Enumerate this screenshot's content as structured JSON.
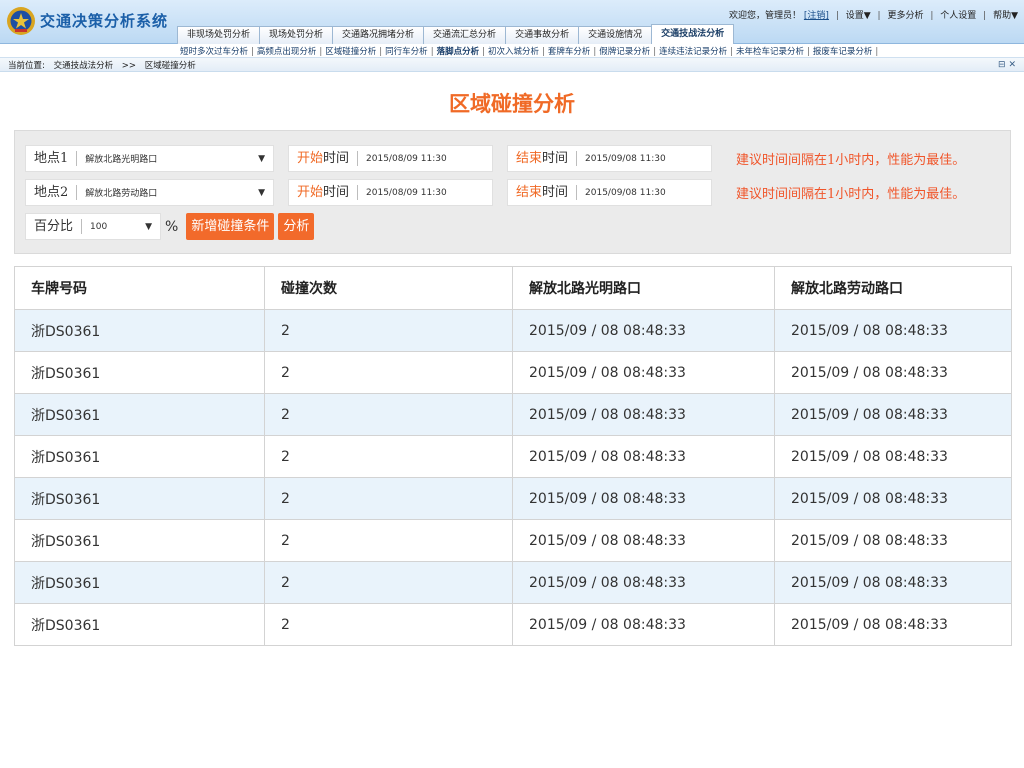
{
  "header": {
    "app_title": "交通决策分析系统",
    "welcome": "欢迎您，管理员！",
    "logout": "[注销]",
    "settings": "设置▼",
    "more_analysis": "更多分析",
    "personal_settings": "个人设置",
    "help": "帮助▼"
  },
  "tabs": [
    {
      "label": "非现场处罚分析"
    },
    {
      "label": "现场处罚分析"
    },
    {
      "label": "交通路况拥堵分析"
    },
    {
      "label": "交通流汇总分析"
    },
    {
      "label": "交通事故分析"
    },
    {
      "label": "交通设施情况"
    },
    {
      "label": "交通技战法分析"
    }
  ],
  "subnav": [
    "短时多次过车分析",
    "高频点出现分析",
    "区域碰撞分析",
    "同行车分析",
    "落脚点分析",
    "初次入城分析",
    "套牌车分析",
    "假牌记录分析",
    "连续违法记录分析",
    "未年检车记录分析",
    "报废车记录分析"
  ],
  "breadcrumb": {
    "label": "当前位置:",
    "section": "交通技战法分析",
    "separator": ">>",
    "page": "区域碰撞分析"
  },
  "page_title": "区域碰撞分析",
  "filters": {
    "location1": {
      "label": "地点1",
      "value": "解放北路光明路口"
    },
    "location2": {
      "label": "地点2",
      "value": "解放北路劳动路口"
    },
    "start_label_a": "开始",
    "start_label_b": "时间",
    "end_label_a": "结束",
    "end_label_b": "时间",
    "row1_start": "2015/08/09  11:30",
    "row1_end": "2015/09/08  11:30",
    "row2_start": "2015/08/09  11:30",
    "row2_end": "2015/09/08  11:30",
    "hint": "建议时间间隔在1小时内，性能为最佳。",
    "percent_label": "百分比",
    "percent_value": "100",
    "percent_sign": "%",
    "add_button": "新增碰撞条件",
    "analyze_button": "分析"
  },
  "table": {
    "columns": [
      "车牌号码",
      "碰撞次数",
      "解放北路光明路口",
      "解放北路劳动路口"
    ],
    "rows": [
      [
        "浙DS0361",
        "2",
        "2015/09 / 08  08:48:33",
        "2015/09 / 08  08:48:33"
      ],
      [
        "浙DS0361",
        "2",
        "2015/09 / 08  08:48:33",
        "2015/09 / 08  08:48:33"
      ],
      [
        "浙DS0361",
        "2",
        "2015/09 / 08  08:48:33",
        "2015/09 / 08  08:48:33"
      ],
      [
        "浙DS0361",
        "2",
        "2015/09 / 08  08:48:33",
        "2015/09 / 08  08:48:33"
      ],
      [
        "浙DS0361",
        "2",
        "2015/09 / 08  08:48:33",
        "2015/09 / 08  08:48:33"
      ],
      [
        "浙DS0361",
        "2",
        "2015/09 / 08  08:48:33",
        "2015/09 / 08  08:48:33"
      ],
      [
        "浙DS0361",
        "2",
        "2015/09 / 08  08:48:33",
        "2015/09 / 08  08:48:33"
      ],
      [
        "浙DS0361",
        "2",
        "2015/09 / 08  08:48:33",
        "2015/09 / 08  08:48:33"
      ]
    ]
  },
  "colors": {
    "accent": "#f26a2b",
    "hint": "#f0552a",
    "row_alt": "#e9f3fb",
    "header_blue": "#bcd9f3"
  }
}
